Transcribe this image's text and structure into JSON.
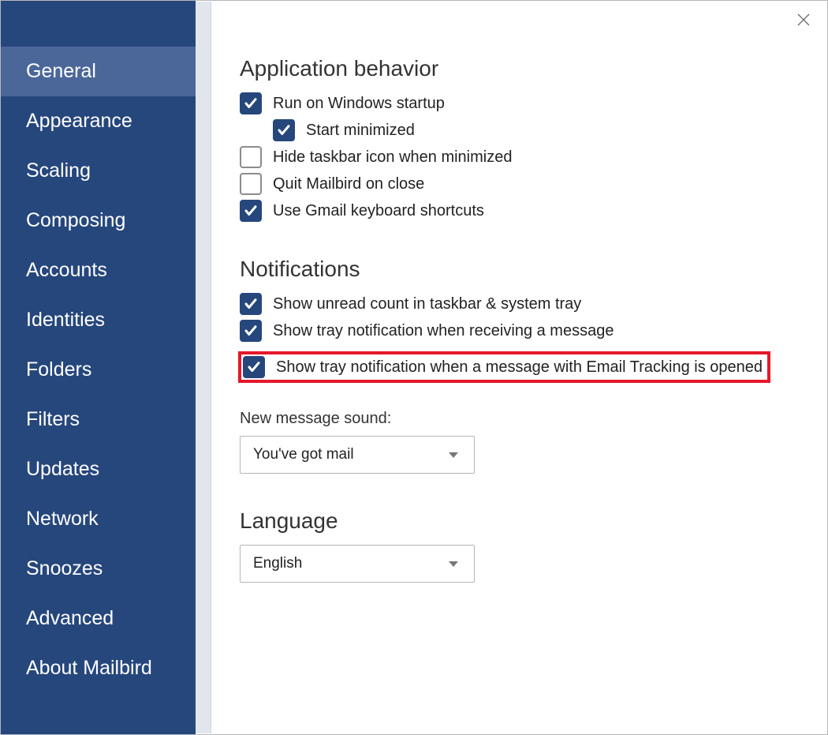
{
  "sidebar": {
    "items": [
      {
        "label": "General",
        "active": true
      },
      {
        "label": "Appearance",
        "active": false
      },
      {
        "label": "Scaling",
        "active": false
      },
      {
        "label": "Composing",
        "active": false
      },
      {
        "label": "Accounts",
        "active": false
      },
      {
        "label": "Identities",
        "active": false
      },
      {
        "label": "Folders",
        "active": false
      },
      {
        "label": "Filters",
        "active": false
      },
      {
        "label": "Updates",
        "active": false
      },
      {
        "label": "Network",
        "active": false
      },
      {
        "label": "Snoozes",
        "active": false
      },
      {
        "label": "Advanced",
        "active": false
      },
      {
        "label": "About Mailbird",
        "active": false
      }
    ]
  },
  "sections": {
    "behavior": {
      "title": "Application behavior",
      "run_on_startup": {
        "label": "Run on Windows startup",
        "checked": true
      },
      "start_minimized": {
        "label": "Start minimized",
        "checked": true
      },
      "hide_taskbar_icon": {
        "label": "Hide taskbar icon when minimized",
        "checked": false
      },
      "quit_on_close": {
        "label": "Quit Mailbird on close",
        "checked": false
      },
      "gmail_shortcuts": {
        "label": "Use Gmail keyboard shortcuts",
        "checked": true
      }
    },
    "notifications": {
      "title": "Notifications",
      "unread_count": {
        "label": "Show unread count in taskbar & system tray",
        "checked": true
      },
      "tray_on_receive": {
        "label": "Show tray notification when receiving a message",
        "checked": true
      },
      "tray_on_tracking_open": {
        "label": "Show tray notification when a message with Email Tracking is opened",
        "checked": true
      },
      "sound_label": "New message sound:",
      "sound_value": "You've got mail"
    },
    "language": {
      "title": "Language",
      "value": "English"
    }
  }
}
